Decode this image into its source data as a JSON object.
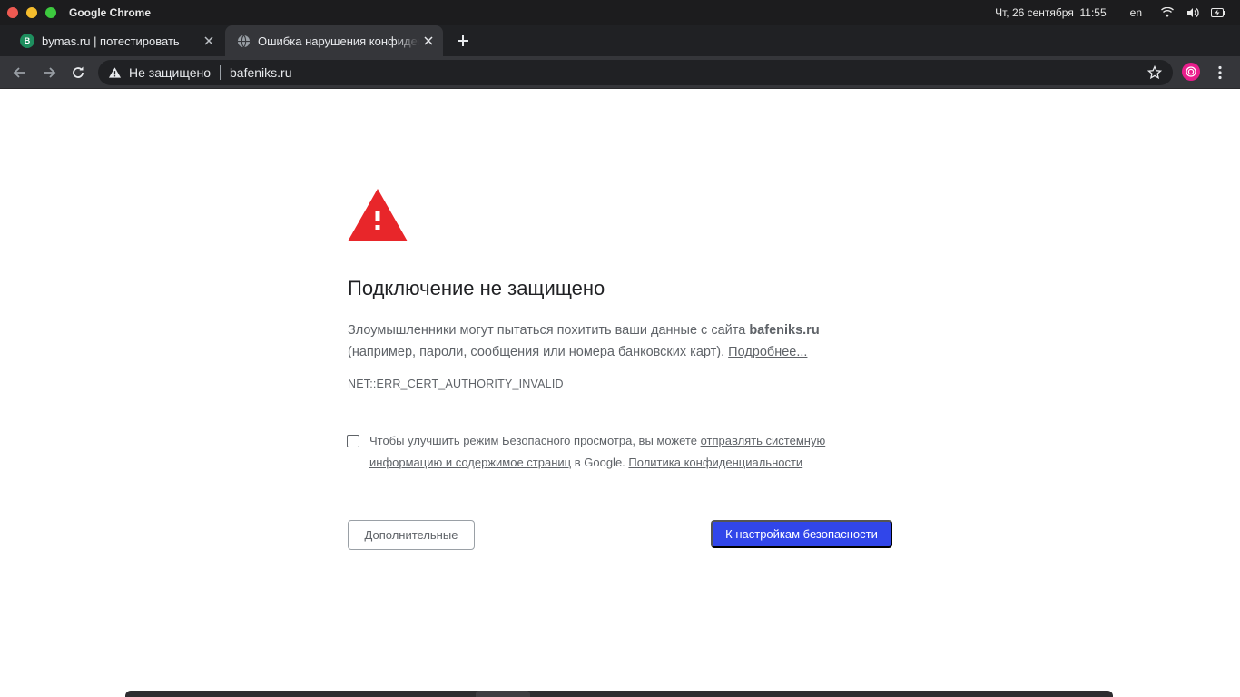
{
  "system": {
    "app_name": "Google Chrome",
    "datetime": "Чт, 26 сентября  11:55",
    "lang": "en"
  },
  "tabs": [
    {
      "title": "bymas.ru | потестировать",
      "favicon_letter": "B",
      "favicon_color": "#1e8e5e"
    },
    {
      "title": "Ошибка нарушения конфиденциальности"
    }
  ],
  "toolbar": {
    "security_status": "Не защищено",
    "url": "bafeniks.ru"
  },
  "page": {
    "heading": "Подключение не защищено",
    "desc_before": "Злоумышленники могут пытаться похитить ваши данные с сайта ",
    "desc_site": "bafeniks.ru",
    "desc_after": " (например, пароли, сообщения или номера банковских карт). ",
    "learn_more": "Подробнее...",
    "error_code": "NET::ERR_CERT_AUTHORITY_INVALID",
    "optin_before": "Чтобы улучшить режим Безопасного просмотра, вы можете ",
    "optin_link": "отправлять системную информацию и содержимое страниц",
    "optin_middle": " в Google. ",
    "privacy_link": "Политика конфиденциальности",
    "advanced_button": "Дополнительные",
    "primary_button": "К настройкам безопасности"
  },
  "colors": {
    "warning_red": "#e8262a",
    "primary_blue": "#3146ea"
  }
}
